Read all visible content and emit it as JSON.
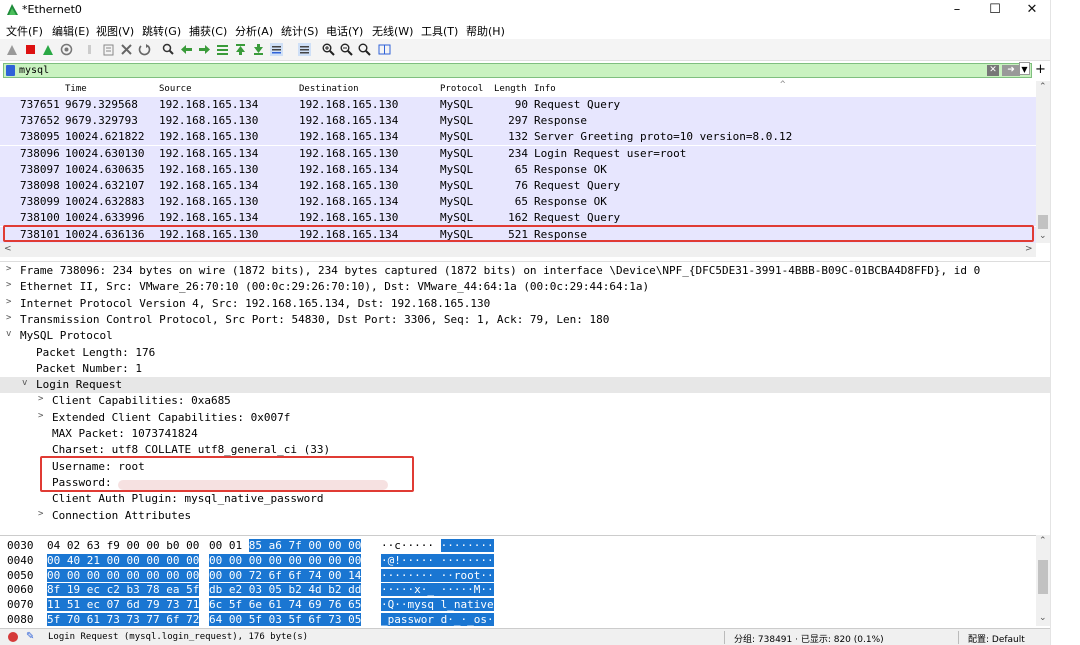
{
  "window": {
    "title": "*Ethernet0"
  },
  "menu": [
    "文件(F)",
    "编辑(E)",
    "视图(V)",
    "跳转(G)",
    "捕获(C)",
    "分析(A)",
    "统计(S)",
    "电话(Y)",
    "无线(W)",
    "工具(T)",
    "帮助(H)"
  ],
  "filter": {
    "value": "mysql"
  },
  "packet_list": {
    "columns": [
      "Time",
      "Source",
      "Destination",
      "Protocol",
      "Length",
      "Info"
    ],
    "rows": [
      {
        "no": "737651",
        "time": "9679.329568",
        "src": "192.168.165.134",
        "dst": "192.168.165.130",
        "proto": "MySQL",
        "len": "90",
        "info": "Request Query"
      },
      {
        "no": "737652",
        "time": "9679.329793",
        "src": "192.168.165.130",
        "dst": "192.168.165.134",
        "proto": "MySQL",
        "len": "297",
        "info": "Response"
      },
      {
        "no": "738095",
        "time": "10024.621822",
        "src": "192.168.165.130",
        "dst": "192.168.165.134",
        "proto": "MySQL",
        "len": "132",
        "info": "Server Greeting proto=10 version=8.0.12"
      },
      {
        "no": "738096",
        "time": "10024.630130",
        "src": "192.168.165.134",
        "dst": "192.168.165.130",
        "proto": "MySQL",
        "len": "234",
        "info": "Login Request user=root"
      },
      {
        "no": "738097",
        "time": "10024.630635",
        "src": "192.168.165.130",
        "dst": "192.168.165.134",
        "proto": "MySQL",
        "len": "65",
        "info": "Response OK"
      },
      {
        "no": "738098",
        "time": "10024.632107",
        "src": "192.168.165.134",
        "dst": "192.168.165.130",
        "proto": "MySQL",
        "len": "76",
        "info": "Request Query"
      },
      {
        "no": "738099",
        "time": "10024.632883",
        "src": "192.168.165.130",
        "dst": "192.168.165.134",
        "proto": "MySQL",
        "len": "65",
        "info": "Response OK"
      },
      {
        "no": "738100",
        "time": "10024.633996",
        "src": "192.168.165.134",
        "dst": "192.168.165.130",
        "proto": "MySQL",
        "len": "162",
        "info": "Request Query"
      },
      {
        "no": "738101",
        "time": "10024.636136",
        "src": "192.168.165.130",
        "dst": "192.168.165.134",
        "proto": "MySQL",
        "len": "521",
        "info": "Response"
      }
    ]
  },
  "details": [
    {
      "text": "Frame 738096: 234 bytes on wire (1872 bits), 234 bytes captured (1872 bits) on interface \\Device\\NPF_{DFC5DE31-3991-4BBB-B09C-01BCBA4D8FFD}, id 0",
      "toggle": ">"
    },
    {
      "text": "Ethernet II, Src: VMware_26:70:10 (00:0c:29:26:70:10), Dst: VMware_44:64:1a (00:0c:29:44:64:1a)",
      "toggle": ">"
    },
    {
      "text": "Internet Protocol Version 4, Src: 192.168.165.134, Dst: 192.168.165.130",
      "toggle": ">"
    },
    {
      "text": "Transmission Control Protocol, Src Port: 54830, Dst Port: 3306, Seq: 1, Ack: 79, Len: 180",
      "toggle": ">"
    },
    {
      "text": "MySQL Protocol",
      "toggle": "v"
    },
    {
      "text": "Packet Length: 176",
      "toggle": ""
    },
    {
      "text": "Packet Number: 1",
      "toggle": ""
    },
    {
      "text": "Login Request",
      "toggle": "v"
    },
    {
      "text": "Client Capabilities: 0xa685",
      "toggle": ">"
    },
    {
      "text": "Extended Client Capabilities: 0x007f",
      "toggle": ">"
    },
    {
      "text": "MAX Packet: 1073741824",
      "toggle": ""
    },
    {
      "text": "Charset: utf8 COLLATE utf8_general_ci (33)",
      "toggle": ""
    },
    {
      "text": "Username: root",
      "toggle": ""
    },
    {
      "text": "Password:",
      "toggle": ""
    },
    {
      "text": "Client Auth Plugin: mysql_native_password",
      "toggle": ""
    },
    {
      "text": "Connection Attributes",
      "toggle": ">"
    }
  ],
  "bytes": [
    {
      "off": "0030",
      "h1": "04 02 63 f9 00 00 b0 00",
      "h2": "00 01 85 a6 7f 00 00 00",
      "asc": "··c·····  ········"
    },
    {
      "off": "0040",
      "h1": "00 40 21 00 00 00 00 00",
      "h2": "00 00 00 00 00 00 00 00",
      "asc": "·@!·····  ········"
    },
    {
      "off": "0050",
      "h1": "00 00 00 00 00 00 00 00",
      "h2": "00 00 72 6f 6f 74 00 14",
      "asc": "········  ··root··"
    },
    {
      "off": "0060",
      "h1": "8f 19 ec c2 b3 78 ea 5f",
      "h2": "db e2 03 05 b2 4d b2 dd",
      "asc": "·····x·_  ·····M··"
    },
    {
      "off": "0070",
      "h1": "11 51 ec 07 6d 79 73 71",
      "h2": "6c 5f 6e 61 74 69 76 65",
      "asc": "·Q··mysq  l_native"
    },
    {
      "off": "0080",
      "h1": "5f 70 61 73 73 77 6f 72",
      "h2": "64 00 5f 03 5f 6f 73 05",
      "asc": "_passwor  d·_·_os·"
    }
  ],
  "status": {
    "left": "Login Request (mysql.login_request), 176 byte(s)",
    "packets": "分组: 738491 · 已显示: 820 (0.1%)",
    "profile": "配置: Default"
  },
  "colors": {
    "accent": "#1a76d2",
    "highlight_border": "#e03b34",
    "row_bg": "#e7e6fe",
    "filter_bg": "#c9f2c0"
  }
}
